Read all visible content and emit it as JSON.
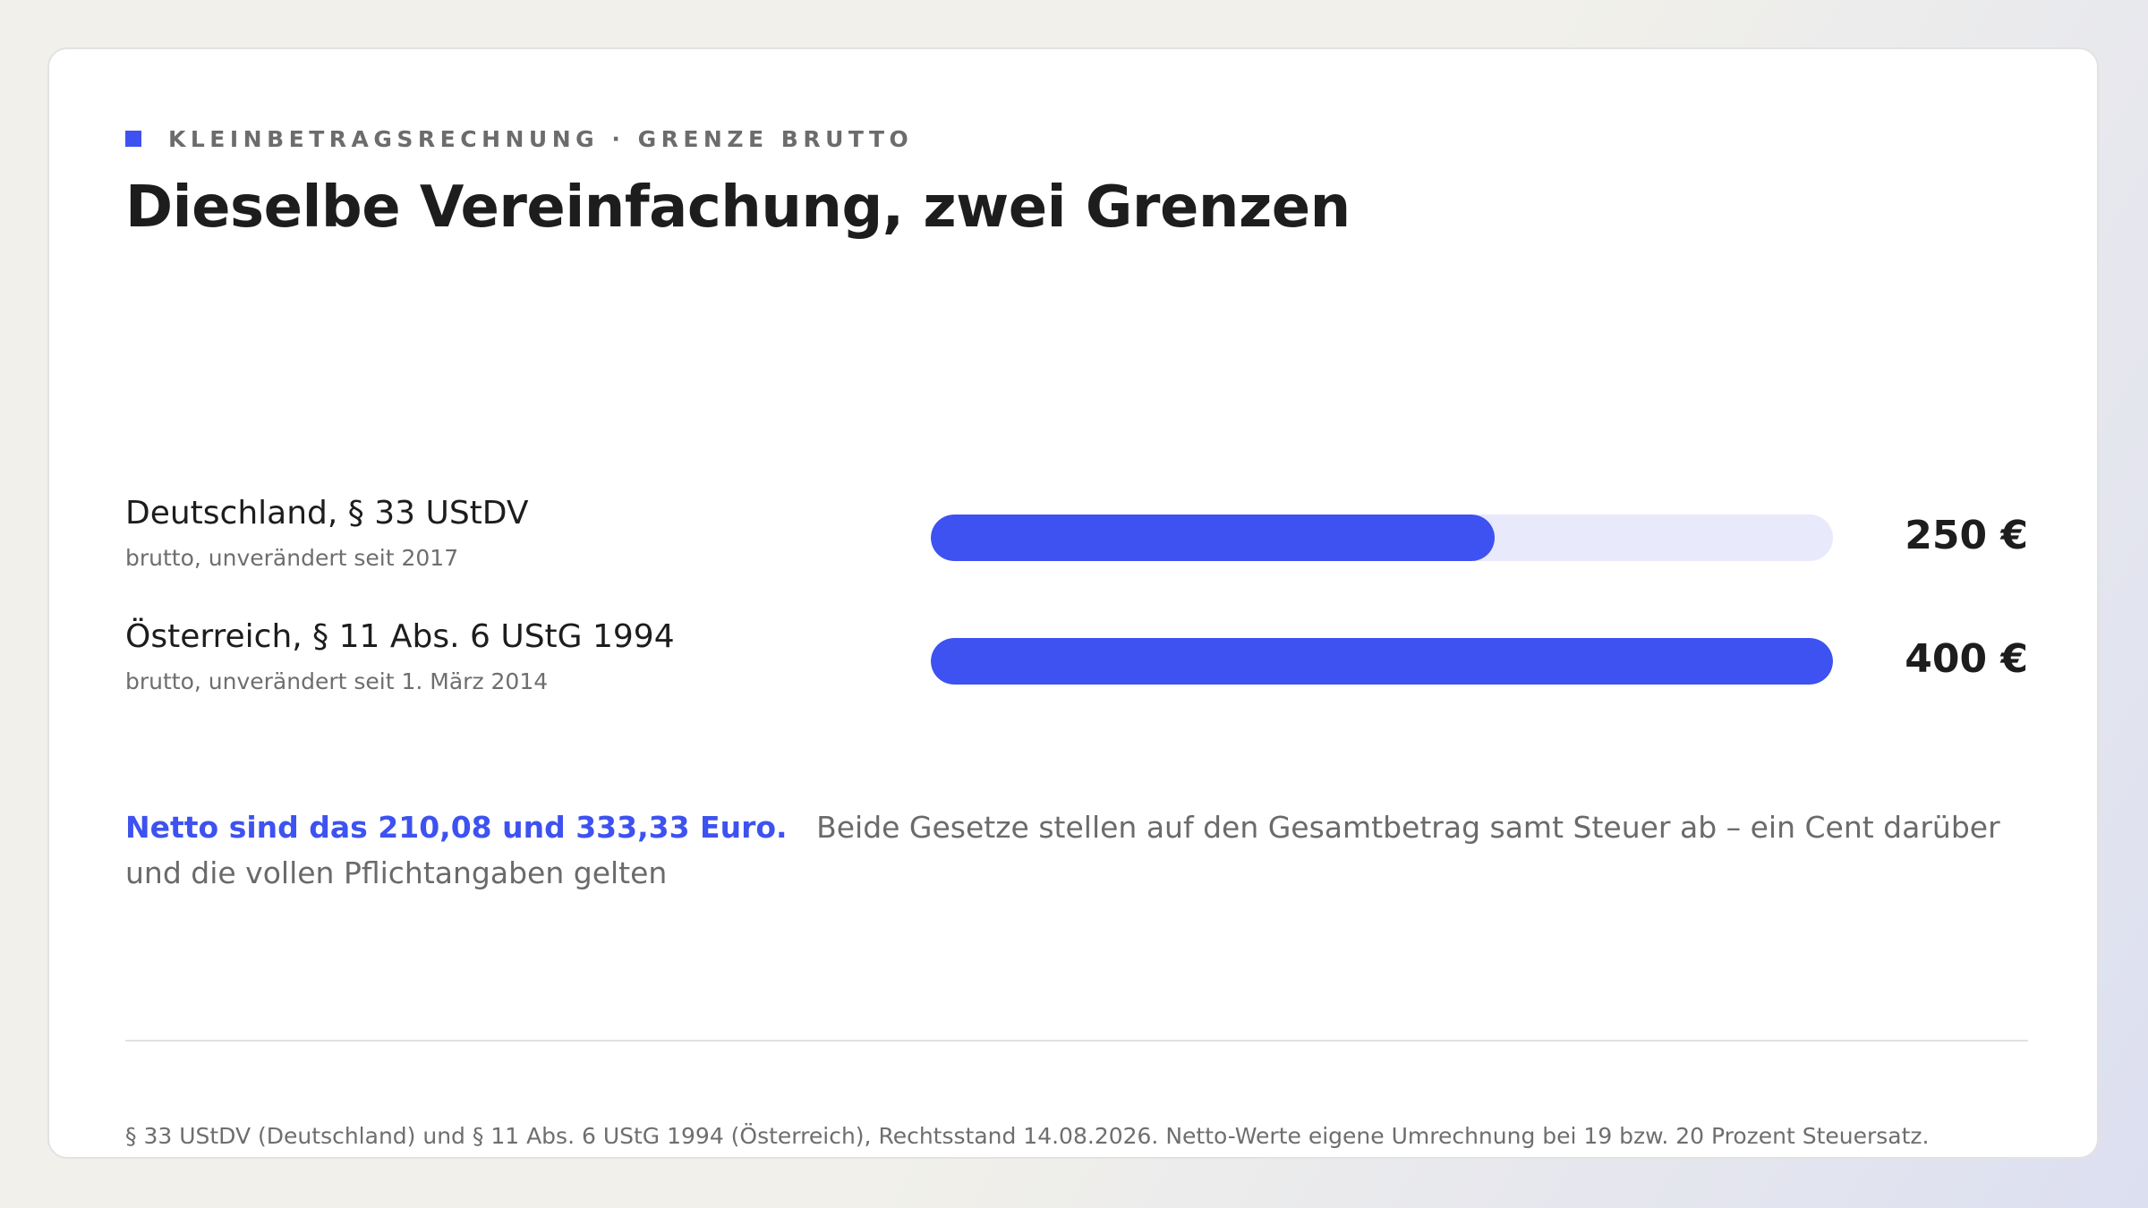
{
  "eyebrow": "KLEINBETRAGSRECHNUNG · GRENZE BRUTTO",
  "title": "Dieselbe Vereinfachung, zwei Grenzen",
  "colors": {
    "accent": "#3d52f0",
    "track": "#e8e9fb",
    "text": "#1d1d1d",
    "muted": "#6e6e6e"
  },
  "chart_data": {
    "type": "bar",
    "orientation": "horizontal",
    "categories": [
      "Deutschland, § 33 UStDV",
      "Österreich, § 11 Abs. 6 UStG 1994"
    ],
    "sublabels": [
      "brutto, unverändert seit 2017",
      "brutto, unverändert seit 1. März 2014"
    ],
    "values": [
      250,
      400
    ],
    "value_labels": [
      "250 €",
      "400 €"
    ],
    "xlim": [
      0,
      400
    ],
    "grid": false,
    "legend": "none"
  },
  "note": {
    "highlight": "Netto sind das 210,08 und 333,33 Euro.",
    "text": "Beide Gesetze stellen auf den Gesamtbetrag samt Steuer ab – ein Cent darüber und die vollen Pflichtangaben gelten"
  },
  "footnote": "§ 33 UStDV (Deutschland) und § 11 Abs. 6 UStG 1994 (Österreich), Rechtsstand 14.08.2026. Netto-Werte eigene Umrechnung bei 19 bzw. 20 Prozent Steuersatz."
}
